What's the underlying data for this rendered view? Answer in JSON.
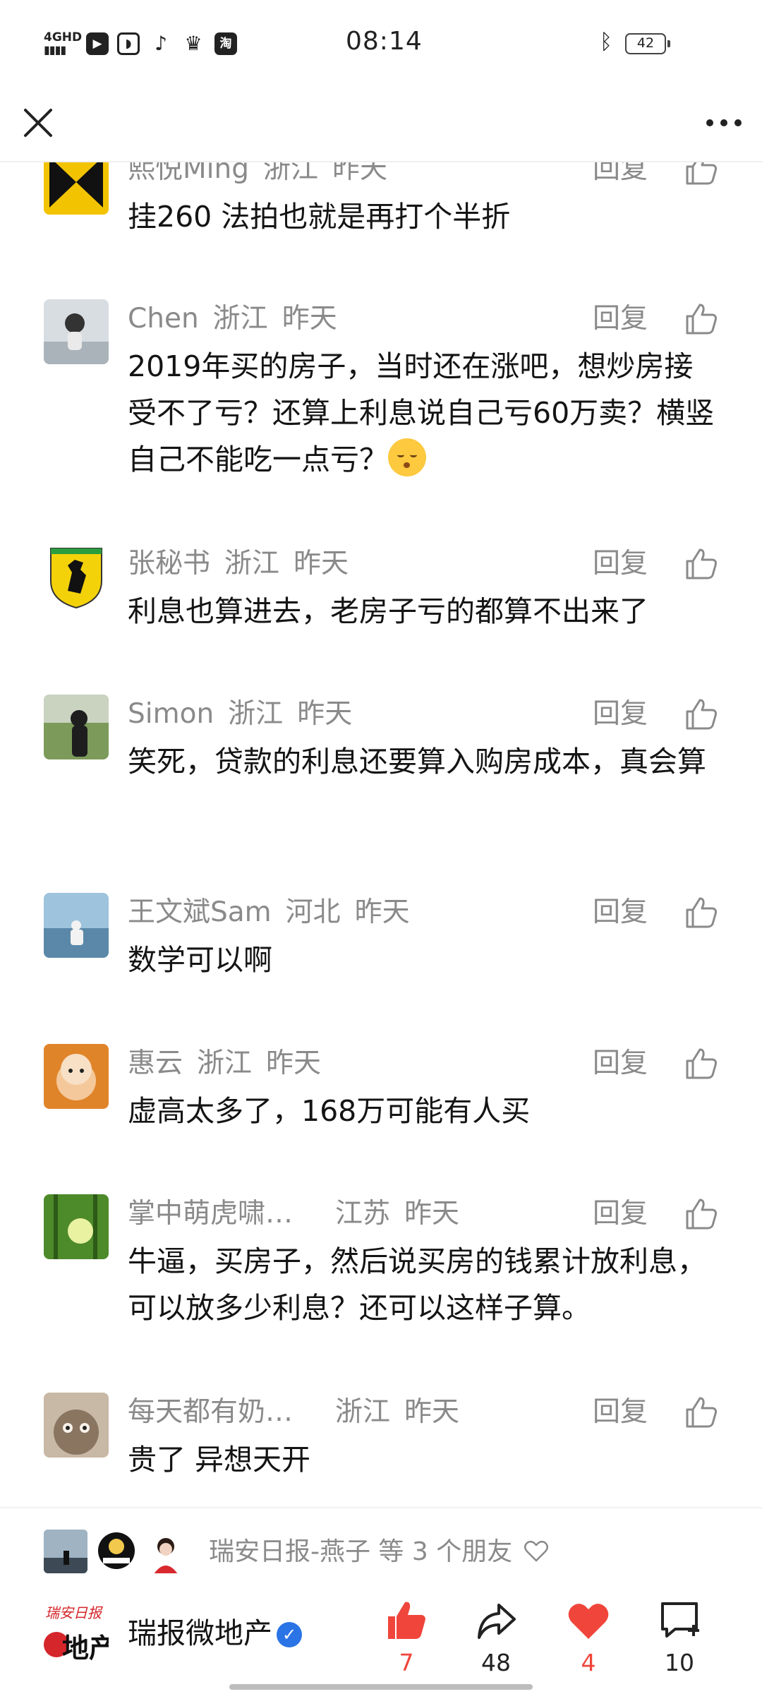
{
  "status_bar": {
    "network": "4GHD",
    "time": "08:14",
    "battery": "42",
    "app_icons": [
      "video-app-icon",
      "leaf-app-icon",
      "tiktok-icon",
      "crown-app-icon",
      "taobao-icon"
    ],
    "taobao_glyph": "淘"
  },
  "header": {
    "close_icon": "close-icon",
    "more_icon": "more-icon"
  },
  "reply_label": "回复",
  "comments": [
    {
      "user": "熙悦Ming",
      "region": "浙江",
      "time": "昨天",
      "text": "挂260 法拍也就是再打个半折"
    },
    {
      "user": "Chen",
      "region": "浙江",
      "time": "昨天",
      "text": "2019年买的房子，当时还在涨吧，想炒房接受不了亏？还算上利息说自己亏60万卖？横竖自己不能吃一点亏？"
    },
    {
      "user": "张秘书",
      "region": "浙江",
      "time": "昨天",
      "text": "利息也算进去，老房子亏的都算不出来了"
    },
    {
      "user": "Simon",
      "region": "浙江",
      "time": "昨天",
      "text": "笑死，贷款的利息还要算入购房成本，真会算"
    },
    {
      "user": "王文斌Sam",
      "region": "河北",
      "time": "昨天",
      "text": "数学可以啊"
    },
    {
      "user": "惠云",
      "region": "浙江",
      "time": "昨天",
      "text": "虚高太多了，168万可能有人买"
    },
    {
      "user": "掌中萌虎啸…",
      "region": "江苏",
      "time": "昨天",
      "text": "牛逼，买房子，然后说买房的钱累计放利息，可以放多少利息？还可以这样子算。"
    },
    {
      "user": "每天都有奶…",
      "region": "浙江",
      "time": "昨天",
      "text": "贵了 异想天开"
    }
  ],
  "friends_bar": {
    "text": "瑞安日报-燕子 等 3 个朋友",
    "heart_icon": "heart-outline-icon"
  },
  "account": {
    "name": "瑞报微地产",
    "logo_text": "地产",
    "logo_top_text": "瑞安日报",
    "verified_mark": "✓",
    "actions": {
      "like": {
        "count": "7",
        "color": "#f0453b"
      },
      "share": {
        "count": "48"
      },
      "heart": {
        "count": "4",
        "color": "#f0453b"
      },
      "comment": {
        "count": "10"
      }
    }
  }
}
